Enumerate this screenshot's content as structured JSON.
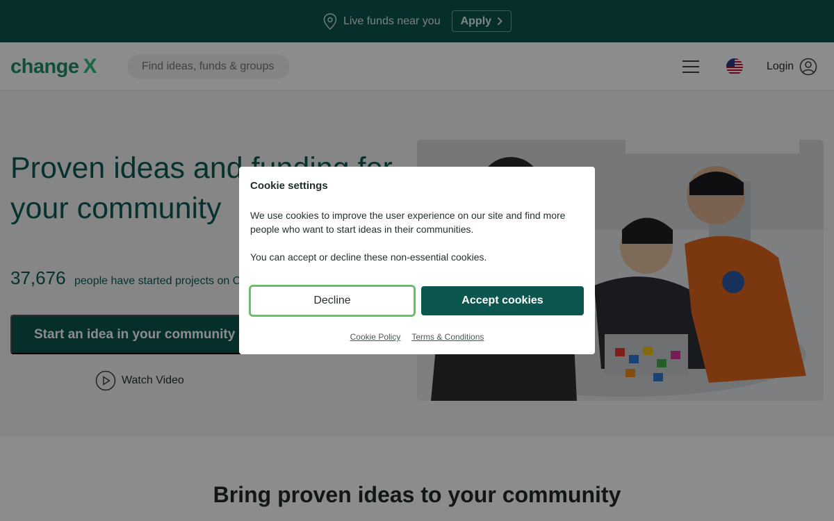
{
  "banner": {
    "live_text": "Live funds near you",
    "apply_label": "Apply"
  },
  "header": {
    "logo_text": "change",
    "logo_mark": "X",
    "search_placeholder": "Find ideas, funds & groups",
    "login_label": "Login",
    "icons": [
      "menu-icon",
      "us-flag-icon",
      "user-icon"
    ]
  },
  "hero": {
    "title": "Proven ideas and funding for your community",
    "count": "37,676",
    "count_text": "people have started projects on ChangeX",
    "cta_label": "Start an idea in your community",
    "watch_label": "Watch Video"
  },
  "section2": {
    "title": "Bring proven ideas to your community"
  },
  "cookie": {
    "title": "Cookie settings",
    "p1": "We use cookies to improve the user experience on our site and find more people who want to start ideas in their communities.",
    "p2": "You can accept or decline these non-essential cookies.",
    "decline_label": "Decline",
    "accept_label": "Accept cookies",
    "policy_link": "Cookie Policy",
    "terms_link": "Terms & Conditions"
  },
  "colors": {
    "brand_dark": "#0b5750",
    "brand_green": "#1f8f6a",
    "focus_ring": "#5fc15a"
  }
}
